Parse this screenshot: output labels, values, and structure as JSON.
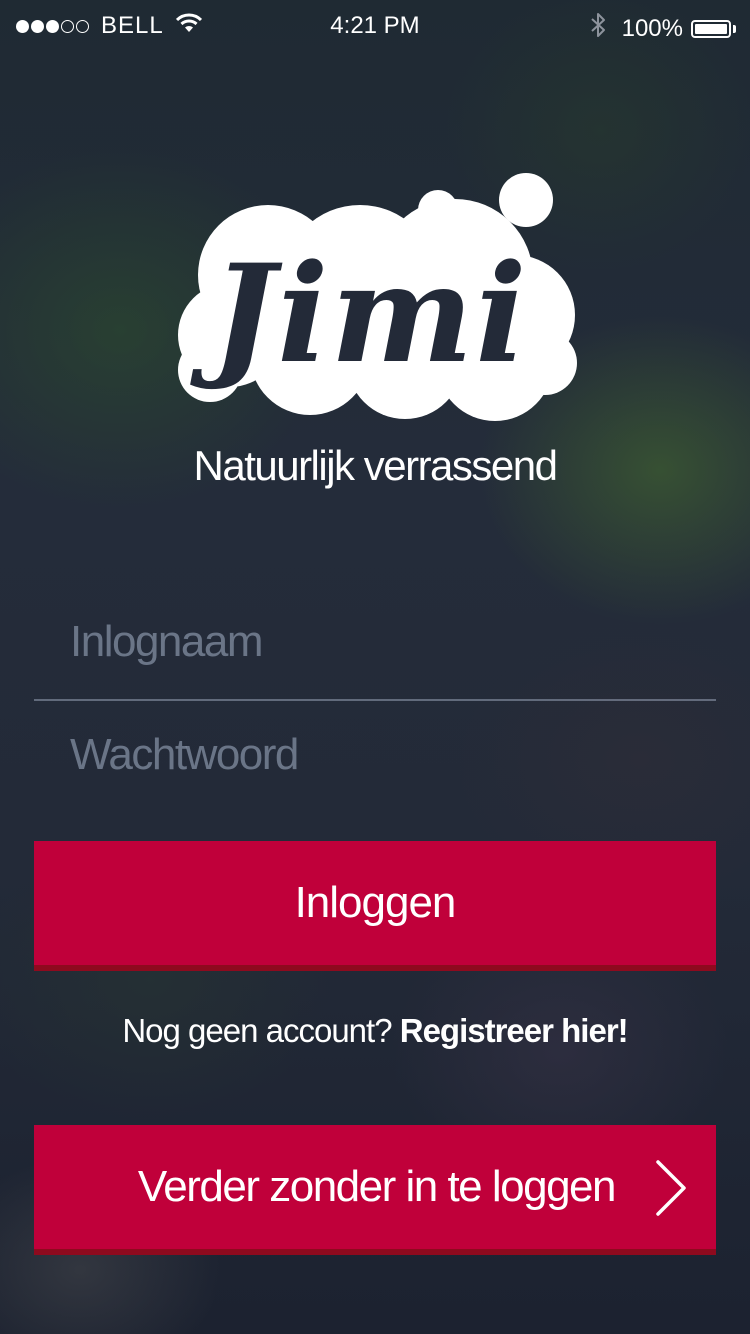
{
  "status_bar": {
    "signal_bars": 3,
    "signal_total": 5,
    "carrier": "BELL",
    "time": "4:21 PM",
    "battery": "100%",
    "battery_level": 1.0
  },
  "brand": {
    "logo_text": "Jimi",
    "tagline": "Natuurlijk verrassend"
  },
  "login_form": {
    "username_placeholder": "Inlognaam",
    "password_placeholder": "Wachtwoord",
    "login_button": "Inloggen"
  },
  "register": {
    "prompt": "Nog geen account?",
    "link": "Registreer hier!"
  },
  "guest_button": {
    "label": "Verder zonder in te loggen",
    "icon": "chevron-right-icon"
  },
  "colors": {
    "primary_button": "#c0003a",
    "button_shadow": "#8e0a1e",
    "background": "#232a38",
    "logo_fill": "#ffffff",
    "logo_text": "#232a38"
  }
}
